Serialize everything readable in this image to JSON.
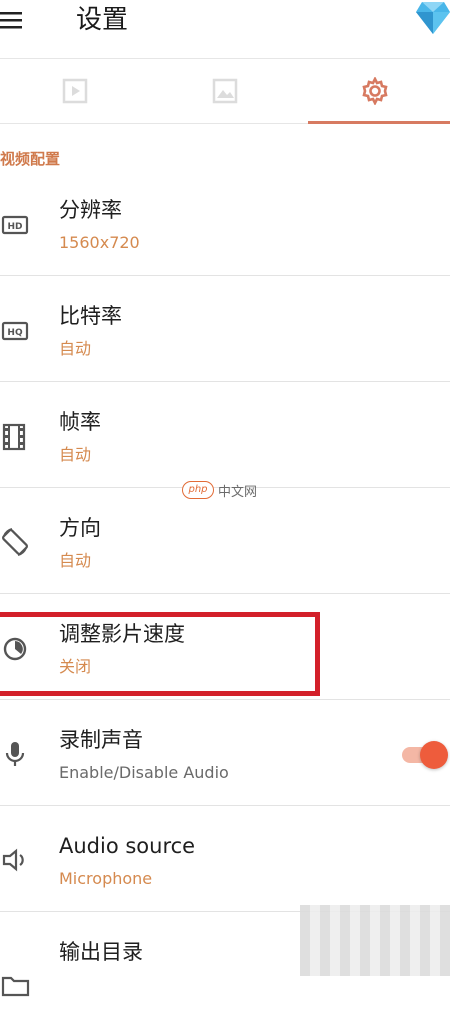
{
  "header": {
    "title": "设置"
  },
  "tabs": [
    {
      "icon": "video-frame-icon",
      "active": false
    },
    {
      "icon": "image-icon",
      "active": false
    },
    {
      "icon": "gear-icon",
      "active": true
    }
  ],
  "colors": {
    "accent": "#d77a61",
    "subtext_orange": "#d58a4f",
    "highlight_red": "#d3202a",
    "toggle_knob": "#ee5c3c"
  },
  "section": {
    "title": "视频配置"
  },
  "settings": [
    {
      "icon": "hd-icon",
      "title": "分辨率",
      "value": "1560x720"
    },
    {
      "icon": "hq-icon",
      "title": "比特率",
      "value": "自动"
    },
    {
      "icon": "film-strip-icon",
      "title": "帧率",
      "value": "自动"
    },
    {
      "icon": "rotate-screen-icon",
      "title": "方向",
      "value": "自动"
    },
    {
      "icon": "speed-dial-icon",
      "title": "调整影片速度",
      "value": "关闭"
    },
    {
      "icon": "microphone-icon",
      "title": "录制声音",
      "value": "Enable/Disable Audio",
      "toggle_on": true
    },
    {
      "icon": "speaker-icon",
      "title": "Audio source",
      "value": "Microphone"
    },
    {
      "icon": "folder-icon",
      "title": "输出目录",
      "value": ""
    }
  ],
  "watermark": {
    "badge": "php",
    "text": "中文网"
  }
}
